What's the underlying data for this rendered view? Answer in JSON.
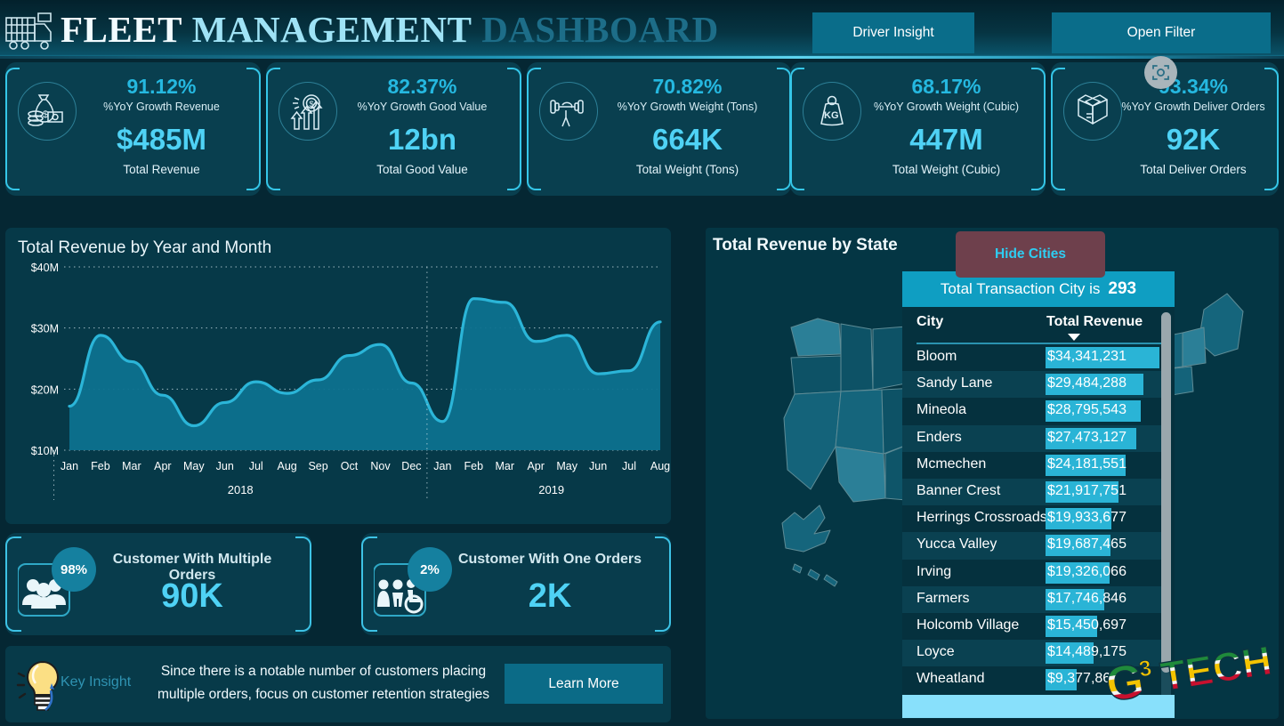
{
  "header": {
    "title_part1": "FLEET",
    "title_part2": "MANAGEMENT",
    "title_part3": "DASHBOARD",
    "logo_icon": "truck-icon",
    "driver_insight_label": "Driver Insight",
    "open_filter_label": "Open Filter"
  },
  "kpis": [
    {
      "icon": "money-bag-icon",
      "pct": "91.12%",
      "pct_label": "%YoY Growth Revenue",
      "value": "$485M",
      "caption": "Total Revenue"
    },
    {
      "icon": "coin-growth-icon",
      "pct": "82.37%",
      "pct_label": "%YoY Growth Good Value",
      "value": "12bn",
      "caption": "Total Good Value"
    },
    {
      "icon": "dumbbell-icon",
      "pct": "70.82%",
      "pct_label": "%YoY Growth Weight (Tons)",
      "value": "664K",
      "caption": "Total Weight (Tons)"
    },
    {
      "icon": "kg-weight-icon",
      "pct": "68.17%",
      "pct_label": "%YoY Growth Weight (Cubic)",
      "value": "447M",
      "caption": "Total Weight (Cubic)"
    },
    {
      "icon": "open-box-icon",
      "pct": "93.34%",
      "pct_label": "%YoY Growth Deliver Orders",
      "value": "92K",
      "caption": "Total Deliver Orders"
    }
  ],
  "scan_overlay_icon": "focus-scan-icon",
  "chart_panel": {
    "title": "Total Revenue by Year and Month"
  },
  "chart_data": {
    "type": "area",
    "title": "Total Revenue by Year and Month",
    "xlabel": "",
    "ylabel": "",
    "ylim": [
      10,
      40
    ],
    "ytick_labels": [
      "$10M",
      "$20M",
      "$30M",
      "$40M"
    ],
    "ytick_values": [
      10,
      20,
      30,
      40
    ],
    "grid": true,
    "grid_style": "dotted",
    "legend": "none",
    "line_color": "#2bb5d8",
    "fill_color": "#0d718f",
    "groups": [
      {
        "year": "2018",
        "categories": [
          "Jan",
          "Feb",
          "Mar",
          "Apr",
          "May",
          "Jun",
          "Jul",
          "Aug",
          "Sep",
          "Oct",
          "Nov",
          "Dec"
        ]
      },
      {
        "year": "2019",
        "categories": [
          "Jan",
          "Feb",
          "Mar",
          "Apr",
          "May",
          "Jun",
          "Jul",
          "Aug"
        ]
      }
    ],
    "x": [
      "2018-Jan",
      "2018-Feb",
      "2018-Mar",
      "2018-Apr",
      "2018-May",
      "2018-Jun",
      "2018-Jul",
      "2018-Aug",
      "2018-Sep",
      "2018-Oct",
      "2018-Nov",
      "2018-Dec",
      "2019-Jan",
      "2019-Feb",
      "2019-Mar",
      "2019-Apr",
      "2019-May",
      "2019-Jun",
      "2019-Jul",
      "2019-Aug"
    ],
    "values": [
      17.2,
      28.8,
      24.5,
      19.0,
      14.0,
      17.8,
      21.2,
      19.3,
      21.5,
      25.5,
      27.3,
      21.0,
      14.7,
      34.8,
      34.2,
      27.8,
      28.8,
      22.5,
      23.0,
      31.0
    ],
    "series": [
      {
        "name": "Total Revenue",
        "values": [
          17.2,
          28.8,
          24.5,
          19.0,
          14.0,
          17.8,
          21.2,
          19.3,
          21.5,
          25.5,
          27.3,
          21.0,
          14.7,
          34.8,
          34.2,
          27.8,
          28.8,
          22.5,
          23.0,
          31.0
        ]
      }
    ]
  },
  "customer_cards": [
    {
      "icon": "group-people-icon",
      "badge": "98%",
      "title": "Customer With Multiple Orders",
      "value": "90K"
    },
    {
      "icon": "accessible-people-icon",
      "badge": "2%",
      "title": "Customer With One Orders",
      "value": "2K"
    }
  ],
  "insight": {
    "icon": "lightbulb-icon",
    "label": "Key Insight",
    "text": "Since there is a notable number of customers placing multiple orders, focus on customer retention strategies",
    "button_label": "Learn More"
  },
  "map_panel": {
    "title": "Total Revenue by State",
    "hide_cities_label": "Hide Cities"
  },
  "city_table": {
    "banner_prefix": "Total Transaction City is",
    "banner_value": "293",
    "col_city": "City",
    "col_revenue": "Total Revenue",
    "sort_icon": "sort-descending-caret",
    "max_value": 34341231,
    "rows": [
      {
        "city": "Bloom",
        "revenue": "$34,341,231",
        "value": 34341231
      },
      {
        "city": "Sandy Lane",
        "revenue": "$29,484,288",
        "value": 29484288
      },
      {
        "city": "Mineola",
        "revenue": "$28,795,543",
        "value": 28795543
      },
      {
        "city": "Enders",
        "revenue": "$27,473,127",
        "value": 27473127
      },
      {
        "city": "Mcmechen",
        "revenue": "$24,181,551",
        "value": 24181551
      },
      {
        "city": "Banner Crest",
        "revenue": "$21,917,751",
        "value": 21917751
      },
      {
        "city": "Herrings Crossroads",
        "revenue": "$19,933,677",
        "value": 19933677
      },
      {
        "city": "Yucca Valley",
        "revenue": "$19,687,465",
        "value": 19687465
      },
      {
        "city": "Irving",
        "revenue": "$19,326,066",
        "value": 19326066
      },
      {
        "city": "Farmers",
        "revenue": "$17,746,846",
        "value": 17746846
      },
      {
        "city": "Holcomb Village",
        "revenue": "$15,450,697",
        "value": 15450697
      },
      {
        "city": "Loyce",
        "revenue": "$14,489,175",
        "value": 14489175
      },
      {
        "city": "Wheatland",
        "revenue": "$9,377,86",
        "value": 9377860
      }
    ]
  },
  "brand_logo": {
    "text_g": "G",
    "text_sup": "3",
    "text_tech": "TECH"
  },
  "colors": {
    "background": "#052733",
    "panel": "#063948",
    "accent_cyan": "#4fd2f5",
    "accent_teal": "#0f9ec2",
    "button_teal": "#0a6d8a",
    "hide_cities_maroon": "#6e404c",
    "data_bar": "#2ab4d6",
    "chart_line": "#2bb5d8",
    "chart_fill": "#0d718f"
  }
}
